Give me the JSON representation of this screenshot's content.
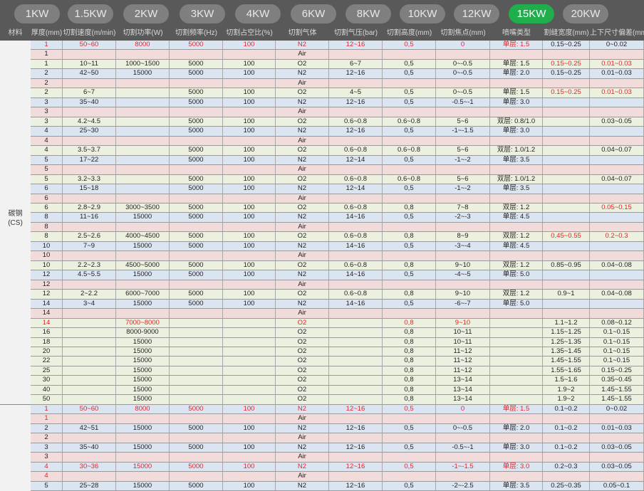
{
  "tabs": [
    "1KW",
    "1.5KW",
    "2KW",
    "3KW",
    "4KW",
    "6KW",
    "8KW",
    "10KW",
    "12KW",
    "15KW",
    "20KW"
  ],
  "active_tab": "15KW",
  "colors": {
    "active": "#1fae4b",
    "highlight": "#e0252a",
    "n2_row": "#dbe5f1",
    "air_row": "#f2dcdb",
    "o2_row": "#ebf1de"
  },
  "headers": [
    "材料",
    "厚度(mm)",
    "切割速度(m/min)",
    "切割功率(W)",
    "切割频率(Hz)",
    "切割占空比(%)",
    "切割气体",
    "切割气压(bar)",
    "切割高度(mm)",
    "切割焦点(mm)",
    "喷嘴类型",
    "割缝宽度(mm)",
    "上下尺寸偏差(mm)"
  ],
  "materials": [
    {
      "label": "碳钢",
      "sub": "(CS)"
    }
  ],
  "rows": [
    {
      "bg": "b",
      "c": [
        "1",
        "50~60",
        "8000",
        "5000",
        "100",
        "N2",
        "12~16",
        "0,5",
        "0",
        "单层: 1.5",
        "0.15~0.25",
        "0~0.02"
      ],
      "red": [
        0,
        1,
        2,
        3,
        4,
        5,
        6,
        7,
        8,
        9
      ]
    },
    {
      "bg": "p",
      "c": [
        "1",
        "",
        "",
        "",
        "",
        "Air",
        "",
        "",
        "",
        "",
        "",
        ""
      ]
    },
    {
      "bg": "g",
      "c": [
        "1",
        "10~11",
        "1000~1500",
        "5000",
        "100",
        "O2",
        "6~7",
        "0,5",
        "0~-0.5",
        "单层: 1.5",
        "0.15~0.25",
        "0.01~0.03"
      ],
      "red": [
        10,
        11
      ]
    },
    {
      "bg": "b",
      "c": [
        "2",
        "42~50",
        "15000",
        "5000",
        "100",
        "N2",
        "12~16",
        "0,5",
        "0~-0.5",
        "单层: 2.0",
        "0.15~0.25",
        "0.01~0.03"
      ]
    },
    {
      "bg": "p",
      "c": [
        "2",
        "",
        "",
        "",
        "",
        "Air",
        "",
        "",
        "",
        "",
        "",
        ""
      ]
    },
    {
      "bg": "g",
      "c": [
        "2",
        "6~7",
        "",
        "5000",
        "100",
        "O2",
        "4~5",
        "0,5",
        "0~-0.5",
        "单层: 1.5",
        "0.15~0.25",
        "0.01~0.03"
      ],
      "red": [
        10,
        11
      ]
    },
    {
      "bg": "b",
      "c": [
        "3",
        "35~40",
        "",
        "5000",
        "100",
        "N2",
        "12~16",
        "0,5",
        "-0.5~-1",
        "单层: 3.0",
        "",
        ""
      ]
    },
    {
      "bg": "p",
      "c": [
        "3",
        "",
        "",
        "",
        "",
        "Air",
        "",
        "",
        "",
        "",
        "",
        ""
      ]
    },
    {
      "bg": "g",
      "c": [
        "3",
        "4.2~4.5",
        "",
        "5000",
        "100",
        "O2",
        "0.6~0.8",
        "0.6~0.8",
        "5~6",
        "双层: 0.8/1.0",
        "",
        "0.03~0.05"
      ]
    },
    {
      "bg": "b",
      "c": [
        "4",
        "25~30",
        "",
        "5000",
        "100",
        "N2",
        "12~16",
        "0,5",
        "-1~-1.5",
        "单层: 3.0",
        "",
        ""
      ]
    },
    {
      "bg": "p",
      "c": [
        "4",
        "",
        "",
        "",
        "",
        "Air",
        "",
        "",
        "",
        "",
        "",
        ""
      ]
    },
    {
      "bg": "g",
      "c": [
        "4",
        "3.5~3.7",
        "",
        "5000",
        "100",
        "O2",
        "0.6~0.8",
        "0.6~0.8",
        "5~6",
        "双层: 1.0/1.2",
        "",
        "0.04~0.07"
      ]
    },
    {
      "bg": "b",
      "c": [
        "5",
        "17~22",
        "",
        "5000",
        "100",
        "N2",
        "12~14",
        "0,5",
        "-1~-2",
        "单层: 3.5",
        "",
        ""
      ]
    },
    {
      "bg": "p",
      "c": [
        "5",
        "",
        "",
        "",
        "",
        "Air",
        "",
        "",
        "",
        "",
        "",
        ""
      ]
    },
    {
      "bg": "g",
      "c": [
        "5",
        "3.2~3.3",
        "",
        "5000",
        "100",
        "O2",
        "0.6~0.8",
        "0.6~0.8",
        "5~6",
        "双层: 1.0/1.2",
        "",
        "0.04~0.07"
      ]
    },
    {
      "bg": "b",
      "c": [
        "6",
        "15~18",
        "",
        "5000",
        "100",
        "N2",
        "12~14",
        "0,5",
        "-1~-2",
        "单层: 3.5",
        "",
        ""
      ]
    },
    {
      "bg": "p",
      "c": [
        "6",
        "",
        "",
        "",
        "",
        "Air",
        "",
        "",
        "",
        "",
        "",
        ""
      ]
    },
    {
      "bg": "g",
      "c": [
        "6",
        "2.8~2.9",
        "3000~3500",
        "5000",
        "100",
        "O2",
        "0.6~0.8",
        "0,8",
        "7~8",
        "双层: 1.2",
        "",
        "0.05~0.15"
      ],
      "red": [
        11
      ]
    },
    {
      "bg": "b",
      "c": [
        "8",
        "11~16",
        "15000",
        "5000",
        "100",
        "N2",
        "14~16",
        "0,5",
        "-2~-3",
        "单层: 4.5",
        "",
        ""
      ]
    },
    {
      "bg": "p",
      "c": [
        "8",
        "",
        "",
        "",
        "",
        "Air",
        "",
        "",
        "",
        "",
        "",
        ""
      ]
    },
    {
      "bg": "g",
      "c": [
        "8",
        "2.5~2.6",
        "4000~4500",
        "5000",
        "100",
        "O2",
        "0.6~0.8",
        "0,8",
        "8~9",
        "双层: 1.2",
        "0.45~0.55",
        "0.2~0.3"
      ],
      "red": [
        10,
        11
      ]
    },
    {
      "bg": "b",
      "c": [
        "10",
        "7~9",
        "15000",
        "5000",
        "100",
        "N2",
        "14~16",
        "0,5",
        "-3~-4",
        "单层: 4.5",
        "",
        ""
      ]
    },
    {
      "bg": "p",
      "c": [
        "10",
        "",
        "",
        "",
        "",
        "Air",
        "",
        "",
        "",
        "",
        "",
        ""
      ]
    },
    {
      "bg": "g",
      "c": [
        "10",
        "2.2~2.3",
        "4500~5000",
        "5000",
        "100",
        "O2",
        "0.6~0.8",
        "0,8",
        "9~10",
        "双层: 1.2",
        "0.85~0.95",
        "0.04~0.08"
      ]
    },
    {
      "bg": "b",
      "c": [
        "12",
        "4.5~5.5",
        "15000",
        "5000",
        "100",
        "N2",
        "14~16",
        "0,5",
        "-4~-5",
        "单层: 5.0",
        "",
        ""
      ]
    },
    {
      "bg": "p",
      "c": [
        "12",
        "",
        "",
        "",
        "",
        "Air",
        "",
        "",
        "",
        "",
        "",
        ""
      ]
    },
    {
      "bg": "g",
      "c": [
        "12",
        "2~2.2",
        "6000~7000",
        "5000",
        "100",
        "O2",
        "0.6~0.8",
        "0,8",
        "9~10",
        "双层: 1.2",
        "0.9~1",
        "0.04~0.08"
      ]
    },
    {
      "bg": "b",
      "c": [
        "14",
        "3~4",
        "15000",
        "5000",
        "100",
        "N2",
        "14~16",
        "0,5",
        "-6~-7",
        "单层: 5.0",
        "",
        ""
      ]
    },
    {
      "bg": "p",
      "c": [
        "14",
        "",
        "",
        "",
        "",
        "Air",
        "",
        "",
        "",
        "",
        "",
        ""
      ]
    },
    {
      "bg": "g",
      "c": [
        "14",
        "",
        "7000~8000",
        "",
        "",
        "O2",
        "",
        "0,8",
        "9~10",
        "",
        "1.1~1.2",
        "0.08~0.12"
      ],
      "red": [
        0,
        2,
        5,
        7,
        8
      ]
    },
    {
      "bg": "g",
      "c": [
        "16",
        "",
        "8000-9000",
        "",
        "",
        "O2",
        "",
        "0,8",
        "10~11",
        "",
        "1.15~1.25",
        "0.1~0.15"
      ]
    },
    {
      "bg": "g",
      "c": [
        "18",
        "",
        "15000",
        "",
        "",
        "O2",
        "",
        "0,8",
        "10~11",
        "",
        "1.25~1.35",
        "0.1~0.15"
      ]
    },
    {
      "bg": "g",
      "c": [
        "20",
        "",
        "15000",
        "",
        "",
        "O2",
        "",
        "0,8",
        "11~12",
        "",
        "1.35~1.45",
        "0.1~0.15"
      ]
    },
    {
      "bg": "g",
      "c": [
        "22",
        "",
        "15000",
        "",
        "",
        "O2",
        "",
        "0,8",
        "11~12",
        "",
        "1.45~1.55",
        "0.1~0.15"
      ]
    },
    {
      "bg": "g",
      "c": [
        "25",
        "",
        "15000",
        "",
        "",
        "O2",
        "",
        "0,8",
        "11~12",
        "",
        "1.55~1.65",
        "0.15~0.25"
      ]
    },
    {
      "bg": "g",
      "c": [
        "30",
        "",
        "15000",
        "",
        "",
        "O2",
        "",
        "0,8",
        "13~14",
        "",
        "1.5~1.6",
        "0.35~0.45"
      ]
    },
    {
      "bg": "g",
      "c": [
        "40",
        "",
        "15000",
        "",
        "",
        "O2",
        "",
        "0,8",
        "13~14",
        "",
        "1.9~2",
        "1.45~1.55"
      ]
    },
    {
      "bg": "g",
      "c": [
        "50",
        "",
        "15000",
        "",
        "",
        "O2",
        "",
        "0,8",
        "13~14",
        "",
        "1.9~2",
        "1.45~1.55"
      ]
    },
    {
      "bg": "b",
      "c": [
        "1",
        "50~60",
        "8000",
        "5000",
        "100",
        "N2",
        "12~16",
        "0,5",
        "0",
        "单层: 1.5",
        "0.1~0.2",
        "0~0.02"
      ],
      "red": [
        0,
        1,
        2,
        3,
        4,
        5,
        6,
        7,
        8,
        9
      ]
    },
    {
      "bg": "p",
      "c": [
        "1",
        "",
        "",
        "",
        "",
        "Air",
        "",
        "",
        "",
        "",
        "",
        ""
      ],
      "red": [
        0
      ]
    },
    {
      "bg": "b",
      "c": [
        "2",
        "42~51",
        "15000",
        "5000",
        "100",
        "N2",
        "12~16",
        "0,5",
        "0~-0.5",
        "单层: 2.0",
        "0.1~0.2",
        "0.01~0.03"
      ]
    },
    {
      "bg": "p",
      "c": [
        "2",
        "",
        "",
        "",
        "",
        "Air",
        "",
        "",
        "",
        "",
        "",
        ""
      ]
    },
    {
      "bg": "b",
      "c": [
        "3",
        "35~40",
        "15000",
        "5000",
        "100",
        "N2",
        "12~16",
        "0,5",
        "-0.5~-1",
        "单层: 3.0",
        "0.1~0.2",
        "0.03~0.05"
      ]
    },
    {
      "bg": "p",
      "c": [
        "3",
        "",
        "",
        "",
        "",
        "Air",
        "",
        "",
        "",
        "",
        "",
        ""
      ]
    },
    {
      "bg": "b",
      "c": [
        "4",
        "30~36",
        "15000",
        "5000",
        "100",
        "N2",
        "12~16",
        "0,5",
        "-1~-1.5",
        "单层: 3.0",
        "0.2~0.3",
        "0.03~0.05"
      ],
      "red": [
        0,
        1,
        2,
        3,
        4,
        5,
        6,
        7,
        8,
        9
      ]
    },
    {
      "bg": "p",
      "c": [
        "4",
        "",
        "",
        "",
        "",
        "Air",
        "",
        "",
        "",
        "",
        "",
        ""
      ],
      "red": [
        0
      ]
    },
    {
      "bg": "b",
      "c": [
        "5",
        "25~28",
        "15000",
        "5000",
        "100",
        "N2",
        "12~16",
        "0,5",
        "-2~-2.5",
        "单层: 3.5",
        "0.25~0.35",
        "0.05~0.1"
      ]
    }
  ]
}
